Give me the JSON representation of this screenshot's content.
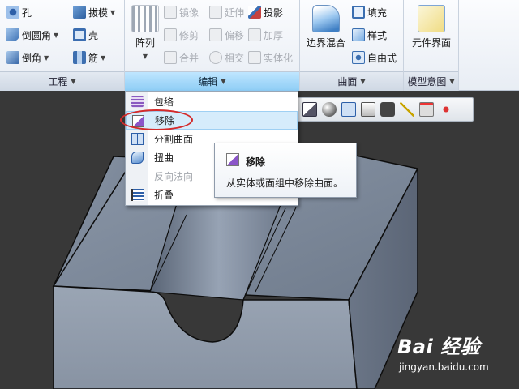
{
  "ribbon": {
    "groups": [
      {
        "label": "工程"
      },
      {
        "label": "编辑"
      },
      {
        "label": "曲面"
      },
      {
        "label": "模型意图"
      }
    ],
    "engineering": {
      "hole": "孔",
      "draft": "拔模",
      "round": "倒圆角",
      "shell": "壳",
      "chamfer": "倒角",
      "rib": "筋"
    },
    "editing": {
      "pattern": "阵列",
      "mirror": "镜像",
      "extend": "延伸",
      "project": "投影",
      "trim": "修剪",
      "offset": "偏移",
      "thicken": "加厚",
      "merge": "合并",
      "intersect": "相交",
      "solidify": "实体化"
    },
    "surfaces": {
      "boundary_blend": "边界混合",
      "fill": "填充",
      "style": "样式",
      "freestyle": "自由式"
    },
    "model_intent": {
      "component_interface": "元件界面"
    }
  },
  "menu": {
    "items": [
      {
        "label": "包络",
        "icon": "wrap-icon",
        "disabled": false
      },
      {
        "label": "移除",
        "icon": "remove-icon",
        "disabled": false,
        "highlighted": true
      },
      {
        "label": "分割曲面",
        "icon": "split-surface-icon",
        "disabled": false
      },
      {
        "label": "扭曲",
        "icon": "warp-icon",
        "disabled": false
      },
      {
        "label": "反向法向",
        "icon": "",
        "disabled": true
      },
      {
        "label": "折叠",
        "icon": "flatten-icon",
        "disabled": false
      }
    ]
  },
  "tooltip": {
    "title": "移除",
    "description": "从实体或面组中移除曲面。"
  },
  "watermark": {
    "logo": "Bai 经验",
    "url": "jingyan.baidu.com"
  },
  "colors": {
    "highlight_ring": "#d42a2a",
    "active_group": "#8ecdf5",
    "model_gray": "#8a95a6"
  }
}
